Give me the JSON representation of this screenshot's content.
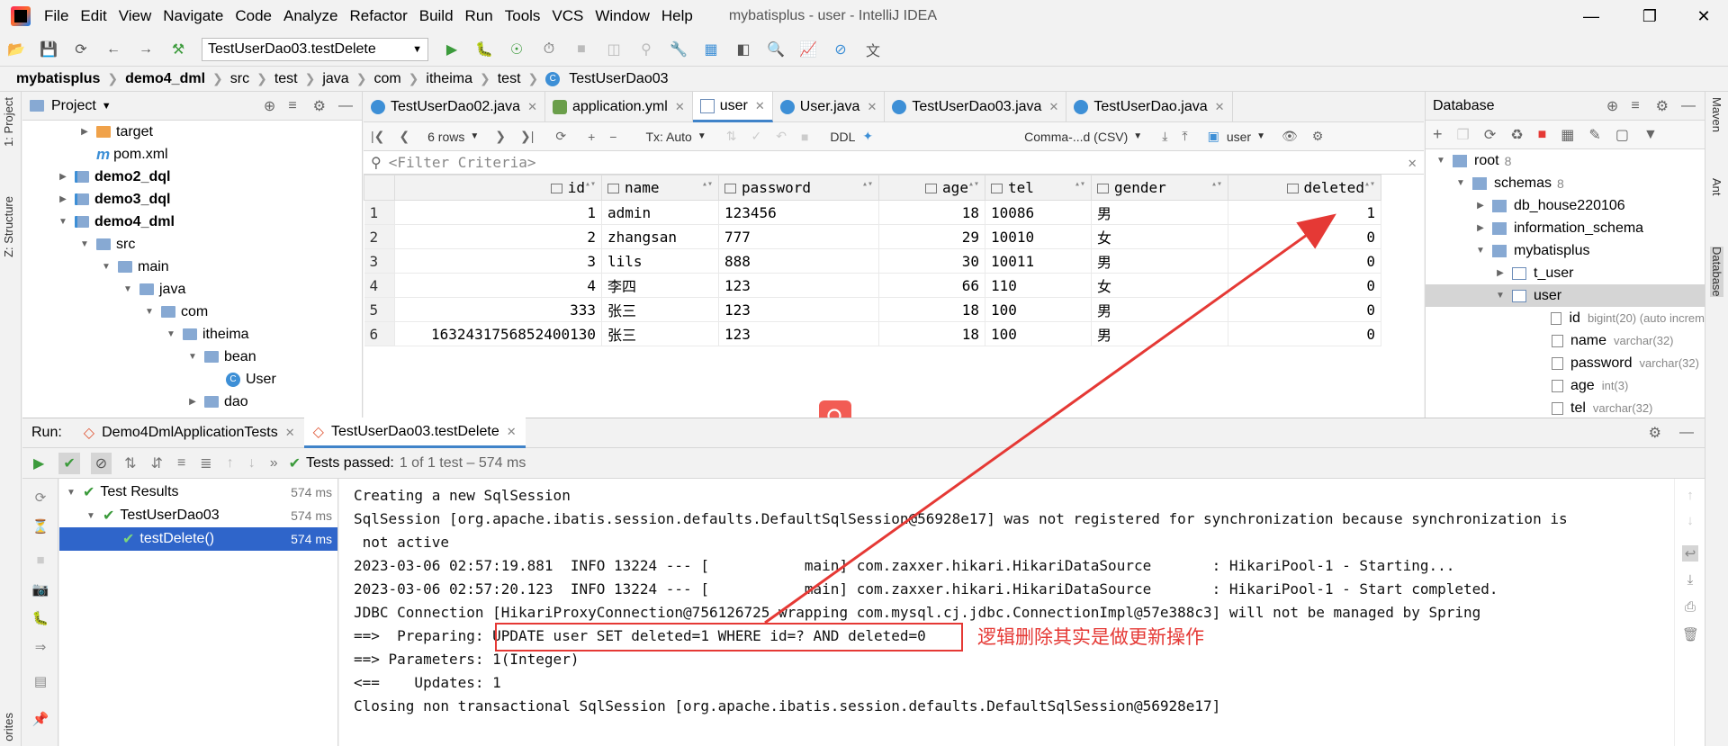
{
  "window": {
    "title": "mybatisplus - user - IntelliJ IDEA",
    "menu": [
      "File",
      "Edit",
      "View",
      "Navigate",
      "Code",
      "Analyze",
      "Refactor",
      "Build",
      "Run",
      "Tools",
      "VCS",
      "Window",
      "Help"
    ]
  },
  "toolbar": {
    "run_config": "TestUserDao03.testDelete"
  },
  "breadcrumb": [
    "mybatisplus",
    "demo4_dml",
    "src",
    "test",
    "java",
    "com",
    "itheima",
    "test",
    "TestUserDao03"
  ],
  "left_stripe": {
    "project_tab": "1: Project",
    "structure_tab": "Z: Structure",
    "favorites_tab": "orites"
  },
  "right_stripe": {
    "maven_tab": "Maven",
    "ant_tab": "Ant",
    "database_tab": "Database"
  },
  "project": {
    "title": "Project",
    "tree": [
      {
        "label": "target",
        "indent": 2,
        "type": "folder-orange",
        "arrow": "right"
      },
      {
        "label": "pom.xml",
        "indent": 2,
        "type": "maven",
        "arrow": ""
      },
      {
        "label": "demo2_dql",
        "indent": 1,
        "type": "module",
        "arrow": "right"
      },
      {
        "label": "demo3_dql",
        "indent": 1,
        "type": "module",
        "arrow": "right"
      },
      {
        "label": "demo4_dml",
        "indent": 1,
        "type": "module",
        "arrow": "down"
      },
      {
        "label": "src",
        "indent": 2,
        "type": "folder",
        "arrow": "down"
      },
      {
        "label": "main",
        "indent": 3,
        "type": "folder",
        "arrow": "down"
      },
      {
        "label": "java",
        "indent": 4,
        "type": "folder",
        "arrow": "down"
      },
      {
        "label": "com",
        "indent": 5,
        "type": "folder",
        "arrow": "down"
      },
      {
        "label": "itheima",
        "indent": 6,
        "type": "folder",
        "arrow": "down"
      },
      {
        "label": "bean",
        "indent": 7,
        "type": "folder",
        "arrow": "down"
      },
      {
        "label": "User",
        "indent": 8,
        "type": "class",
        "arrow": ""
      },
      {
        "label": "dao",
        "indent": 7,
        "type": "folder",
        "arrow": "right"
      }
    ]
  },
  "editor_tabs": [
    {
      "label": "TestUserDao02.java",
      "icon": "class",
      "active": false
    },
    {
      "label": "application.yml",
      "icon": "yml",
      "active": false
    },
    {
      "label": "user",
      "icon": "table",
      "active": true
    },
    {
      "label": "User.java",
      "icon": "class",
      "active": false
    },
    {
      "label": "TestUserDao03.java",
      "icon": "class",
      "active": false
    },
    {
      "label": "TestUserDao.java",
      "icon": "class",
      "active": false
    }
  ],
  "grid_toolbar": {
    "rows": "6 rows",
    "tx": "Tx: Auto",
    "ddl": "DDL",
    "format": "Comma-...d (CSV)",
    "schema": "user"
  },
  "filter": {
    "placeholder": "<Filter Criteria>"
  },
  "grid": {
    "columns": [
      "id",
      "name",
      "password",
      "age",
      "tel",
      "gender",
      "deleted"
    ],
    "rows": [
      {
        "n": "1",
        "id": "1",
        "name": "admin",
        "password": "123456",
        "age": "18",
        "tel": "10086",
        "gender": "男",
        "deleted": "1"
      },
      {
        "n": "2",
        "id": "2",
        "name": "zhangsan",
        "password": "777",
        "age": "29",
        "tel": "10010",
        "gender": "女",
        "deleted": "0"
      },
      {
        "n": "3",
        "id": "3",
        "name": "lils",
        "password": "888",
        "age": "30",
        "tel": "10011",
        "gender": "男",
        "deleted": "0"
      },
      {
        "n": "4",
        "id": "4",
        "name": "李四",
        "password": "123",
        "age": "66",
        "tel": "110",
        "gender": "女",
        "deleted": "0"
      },
      {
        "n": "5",
        "id": "333",
        "name": "张三",
        "password": "123",
        "age": "18",
        "tel": "100",
        "gender": "男",
        "deleted": "0"
      },
      {
        "n": "6",
        "id": "1632431756852400130",
        "name": "张三",
        "password": "123",
        "age": "18",
        "tel": "100",
        "gender": "男",
        "deleted": "0"
      }
    ]
  },
  "database": {
    "title": "Database",
    "tree": [
      {
        "label": "root",
        "extra": "8",
        "indent": 0,
        "arrow": "down",
        "type": "host"
      },
      {
        "label": "schemas",
        "extra": "8",
        "indent": 1,
        "arrow": "down",
        "type": "folder"
      },
      {
        "label": "db_house220106",
        "extra": "",
        "indent": 2,
        "arrow": "right",
        "type": "schema"
      },
      {
        "label": "information_schema",
        "extra": "",
        "indent": 2,
        "arrow": "right",
        "type": "schema"
      },
      {
        "label": "mybatisplus",
        "extra": "",
        "indent": 2,
        "arrow": "down",
        "type": "schema"
      },
      {
        "label": "t_user",
        "extra": "",
        "indent": 3,
        "arrow": "right",
        "type": "table"
      },
      {
        "label": "user",
        "extra": "",
        "indent": 3,
        "arrow": "down",
        "type": "table",
        "selected": true
      },
      {
        "label": "id",
        "extra": "bigint(20) (auto increm",
        "indent": 5,
        "arrow": "",
        "type": "column"
      },
      {
        "label": "name",
        "extra": "varchar(32)",
        "indent": 5,
        "arrow": "",
        "type": "column"
      },
      {
        "label": "password",
        "extra": "varchar(32)",
        "indent": 5,
        "arrow": "",
        "type": "column"
      },
      {
        "label": "age",
        "extra": "int(3)",
        "indent": 5,
        "arrow": "",
        "type": "column"
      },
      {
        "label": "tel",
        "extra": "varchar(32)",
        "indent": 5,
        "arrow": "",
        "type": "column"
      }
    ]
  },
  "run": {
    "label": "Run:",
    "tabs": [
      {
        "label": "Demo4DmlApplicationTests",
        "active": false
      },
      {
        "label": "TestUserDao03.testDelete",
        "active": true
      }
    ],
    "status_bold": "Tests passed:",
    "status_rest": "1 of 1 test – 574 ms",
    "test_tree": [
      {
        "label": "Test Results",
        "time": "574 ms",
        "indent": 0,
        "arrow": "down",
        "selected": false
      },
      {
        "label": "TestUserDao03",
        "time": "574 ms",
        "indent": 1,
        "arrow": "down",
        "selected": false
      },
      {
        "label": "testDelete()",
        "time": "574 ms",
        "indent": 2,
        "arrow": "",
        "selected": true
      }
    ],
    "console": [
      "Creating a new SqlSession",
      "SqlSession [org.apache.ibatis.session.defaults.DefaultSqlSession@56928e17] was not registered for synchronization because synchronization is",
      " not active",
      "2023-03-06 02:57:19.881  INFO 13224 --- [           main] com.zaxxer.hikari.HikariDataSource       : HikariPool-1 - Starting...",
      "2023-03-06 02:57:20.123  INFO 13224 --- [           main] com.zaxxer.hikari.HikariDataSource       : HikariPool-1 - Start completed.",
      "JDBC Connection [HikariProxyConnection@756126725 wrapping com.mysql.cj.jdbc.ConnectionImpl@57e388c3] will not be managed by Spring",
      "==>  Preparing: UPDATE user SET deleted=1 WHERE id=? AND deleted=0",
      "==> Parameters: 1(Integer)",
      "<==    Updates: 1",
      "Closing non transactional SqlSession [org.apache.ibatis.session.defaults.DefaultSqlSession@56928e17]"
    ]
  },
  "annotation": {
    "text": "逻辑删除其实是做更新操作",
    "color": "#e53935"
  },
  "colors": {
    "accent": "#4083c9",
    "selection": "#2f65ca",
    "pass": "#3c9b3c",
    "annotation": "#e53935"
  }
}
